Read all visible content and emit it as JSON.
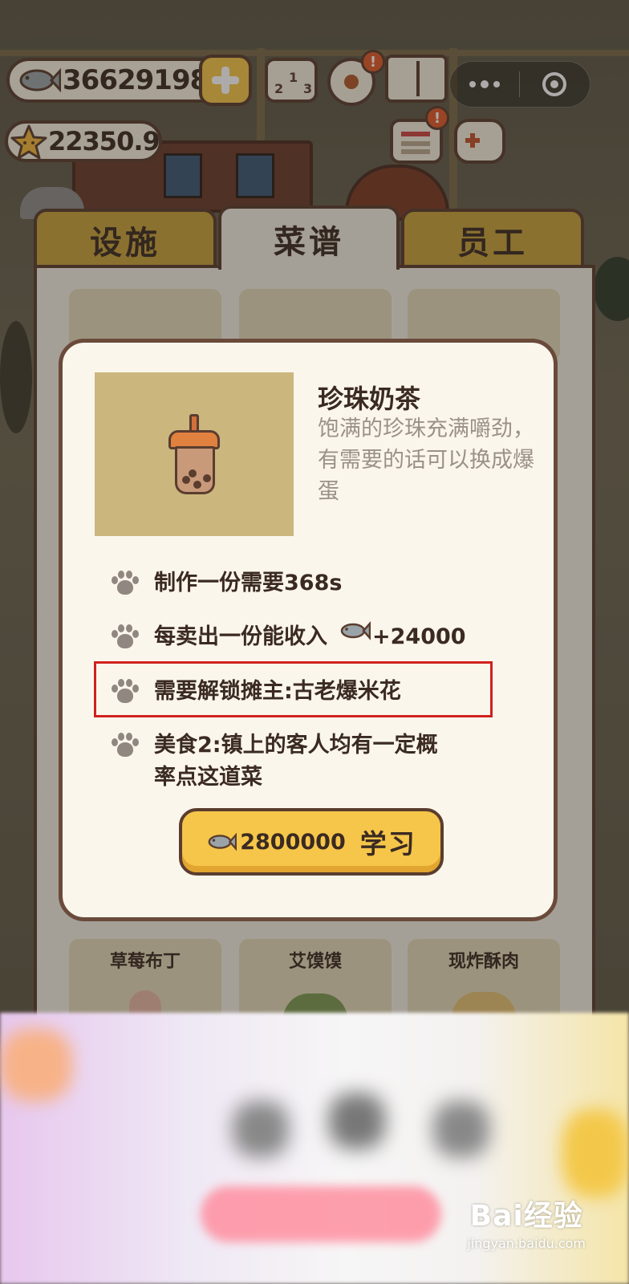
{
  "hud": {
    "fish_amount": "36629198",
    "star_amount": "22350.9",
    "rank_digits": [
      "2",
      "1",
      "3"
    ],
    "badge_mark": "!"
  },
  "tabs": [
    {
      "label": "设施",
      "active": false
    },
    {
      "label": "菜谱",
      "active": true
    },
    {
      "label": "员工",
      "active": false
    }
  ],
  "bottom_cards": [
    {
      "label": "草莓布丁"
    },
    {
      "label": "艾馍馍"
    },
    {
      "label": "现炸酥肉"
    }
  ],
  "dialog": {
    "title": "珍珠奶茶",
    "description": "饱满的珍珠充满嚼劲，有需要的话可以换成爆蛋",
    "rows": {
      "craft_time": "制作一份需要368s",
      "income_label": "每卖出一份能收入",
      "income_value": "+24000",
      "unlock": "需要解锁摊主:古老爆米花",
      "buff": "美食2:镇上的客人均有一定概率点这道菜"
    },
    "learn_button": {
      "cost": "2800000",
      "action": "学习"
    }
  },
  "watermark": {
    "brand": "Bai经验",
    "url": "jingyan.baidu.com"
  },
  "colors": {
    "accent_yellow": "#f6c64a",
    "outline_brown": "#5a3d2e",
    "highlight_red": "#d0211f"
  }
}
